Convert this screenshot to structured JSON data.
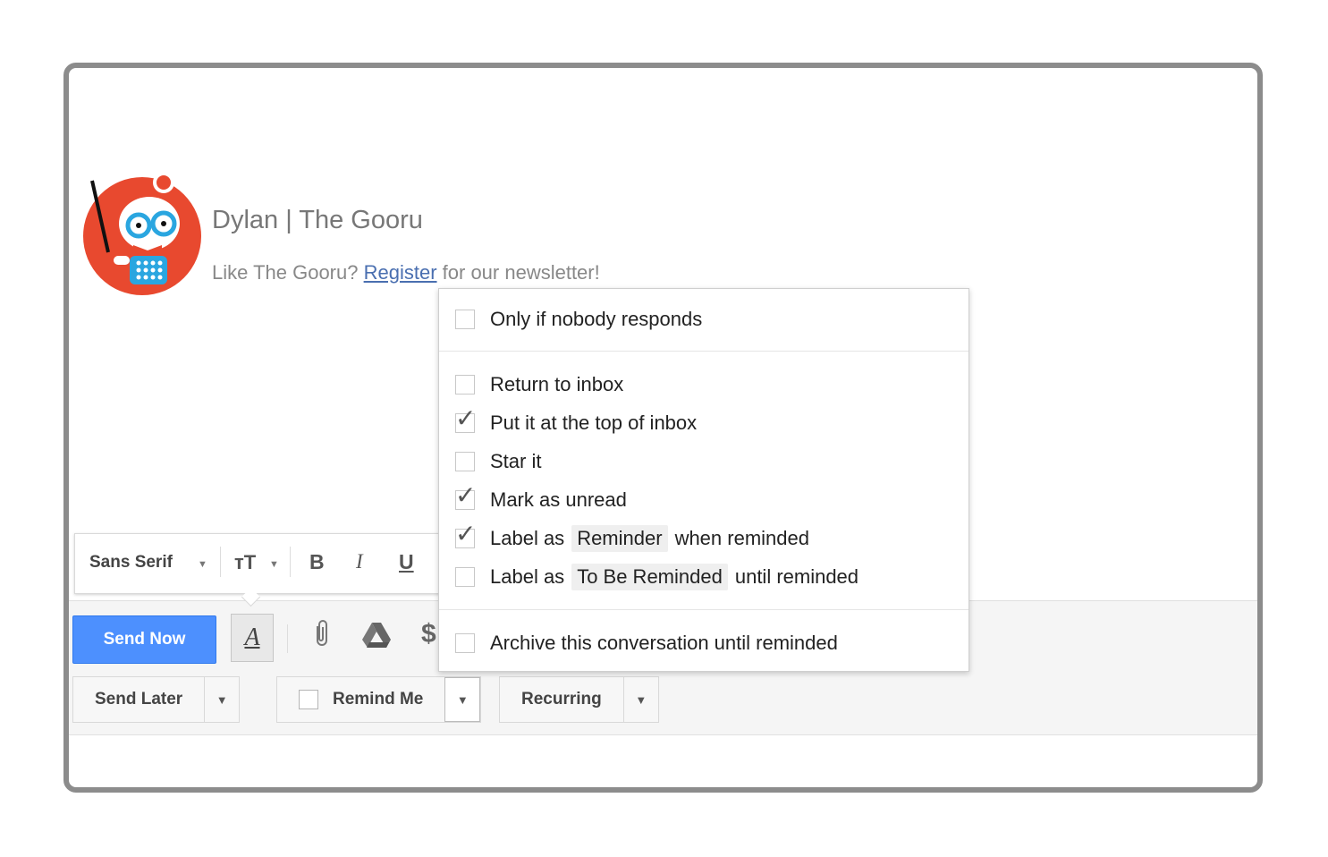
{
  "signature": {
    "name": "Dylan | The Gooru",
    "line_prefix": "Like The Gooru?",
    "link_text": "Register",
    "line_suffix": "for our newsletter!"
  },
  "format_bar": {
    "font": "Sans Serif",
    "bold": "B",
    "italic": "I",
    "underline": "U"
  },
  "toolbar": {
    "send_now": "Send Now",
    "format_toggle": "A",
    "send_later": "Send Later",
    "remind_me": "Remind Me",
    "recurring": "Recurring"
  },
  "remind_menu": {
    "items": [
      {
        "label": "Only if nobody responds",
        "checked": false
      },
      {
        "label": "Return to inbox",
        "checked": false
      },
      {
        "label": "Put it at the top of inbox",
        "checked": true
      },
      {
        "label": "Star it",
        "checked": false
      },
      {
        "label": "Mark as unread",
        "checked": true
      },
      {
        "prefix": "Label as",
        "chip": "Reminder",
        "suffix": "when reminded",
        "checked": true
      },
      {
        "prefix": "Label as",
        "chip": "To Be Reminded",
        "suffix": "until reminded",
        "checked": false
      },
      {
        "label": "Archive this conversation until reminded",
        "checked": false
      }
    ]
  },
  "colors": {
    "send_button": "#4d90fe",
    "avatar_red": "#e8492f",
    "link": "#4a6fb0"
  }
}
